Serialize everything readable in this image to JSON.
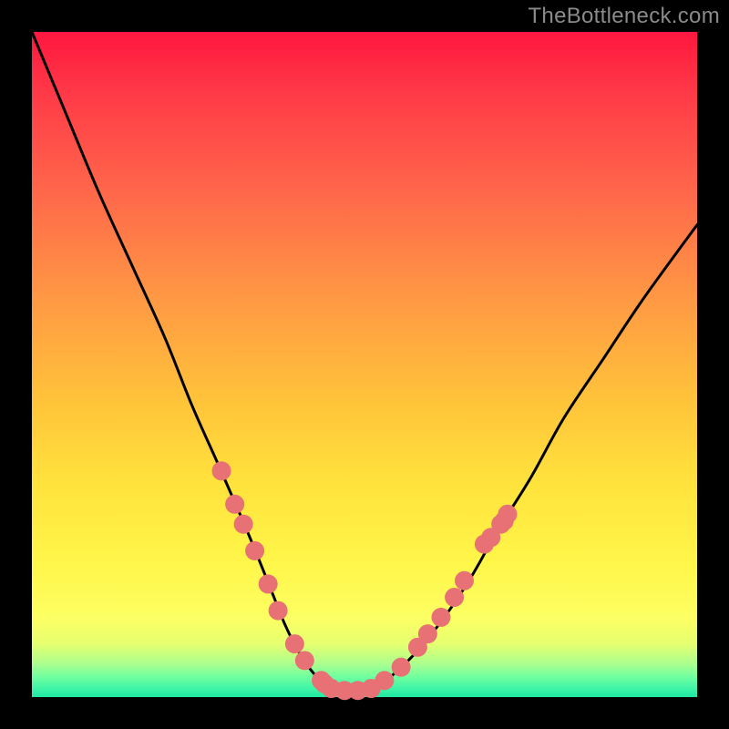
{
  "watermark": "TheBottleneck.com",
  "colors": {
    "curve_stroke": "#000000",
    "marker_fill": "#e77174",
    "marker_stroke": "#c2585f"
  },
  "chart_data": {
    "type": "line",
    "title": "",
    "xlabel": "",
    "ylabel": "",
    "xlim": [
      0,
      100
    ],
    "ylim": [
      0,
      100
    ],
    "series": [
      {
        "name": "bottleneck-curve",
        "x": [
          0,
          5,
          10,
          15,
          20,
          24,
          28,
          31.5,
          34,
          36,
          38,
          40,
          42,
          44,
          46,
          48,
          50,
          52.5,
          55,
          58,
          62,
          66,
          70,
          75,
          80,
          86,
          92,
          100
        ],
        "y": [
          100,
          88,
          76,
          65,
          54,
          44,
          35,
          27,
          21,
          16,
          11,
          7,
          4,
          2,
          1,
          1,
          1,
          2,
          4,
          7,
          12,
          18,
          25,
          33,
          42,
          51,
          60,
          71
        ]
      }
    ],
    "markers": [
      {
        "x": 28.5,
        "y": 34
      },
      {
        "x": 30.5,
        "y": 29
      },
      {
        "x": 31.8,
        "y": 26
      },
      {
        "x": 33.5,
        "y": 22
      },
      {
        "x": 35.5,
        "y": 17
      },
      {
        "x": 37.0,
        "y": 13
      },
      {
        "x": 39.5,
        "y": 8
      },
      {
        "x": 41.0,
        "y": 5.5
      },
      {
        "x": 43.5,
        "y": 2.5
      },
      {
        "x": 44.0,
        "y": 2.0
      },
      {
        "x": 45.0,
        "y": 1.3
      },
      {
        "x": 47.0,
        "y": 1.0
      },
      {
        "x": 49.0,
        "y": 1.0
      },
      {
        "x": 51.0,
        "y": 1.3
      },
      {
        "x": 53.0,
        "y": 2.5
      },
      {
        "x": 55.5,
        "y": 4.5
      },
      {
        "x": 58.0,
        "y": 7.5
      },
      {
        "x": 59.5,
        "y": 9.5
      },
      {
        "x": 61.5,
        "y": 12
      },
      {
        "x": 63.5,
        "y": 15
      },
      {
        "x": 65.0,
        "y": 17.5
      },
      {
        "x": 68.0,
        "y": 23
      },
      {
        "x": 69.0,
        "y": 24
      },
      {
        "x": 70.5,
        "y": 26
      },
      {
        "x": 71.5,
        "y": 27.5
      },
      {
        "x": 71.0,
        "y": 26.5
      }
    ]
  }
}
